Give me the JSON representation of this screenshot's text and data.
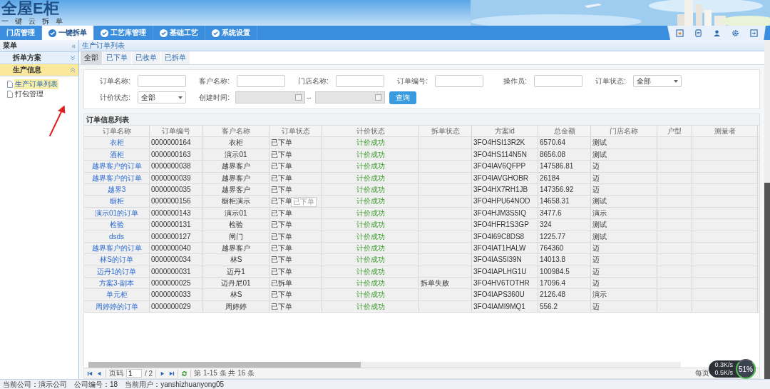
{
  "header": {
    "logo": "全屋E柜",
    "slogan": "一键云拆单"
  },
  "nav": [
    {
      "label": "门店管理",
      "kind": "plain",
      "selected": false
    },
    {
      "label": "一键拆单",
      "kind": "icon",
      "selected": true
    },
    {
      "label": "工艺库管理",
      "kind": "icon",
      "selected": false
    },
    {
      "label": "基础工艺",
      "kind": "icon",
      "selected": false
    },
    {
      "label": "系统设置",
      "kind": "icon",
      "selected": false
    }
  ],
  "sidebar": {
    "title": "菜单",
    "collapse_glyph": "«",
    "sections": [
      {
        "label": "拆单方案",
        "expanded": false
      },
      {
        "label": "生产信息",
        "expanded": true,
        "children": [
          {
            "label": "生产订单列表",
            "selected": true
          },
          {
            "label": "打包管理",
            "selected": false
          }
        ]
      }
    ]
  },
  "breadcrumb": "生产订单列表",
  "status_tabs": [
    {
      "label": "全部",
      "selected": true
    },
    {
      "label": "已下单",
      "selected": false
    },
    {
      "label": "已收单",
      "selected": false
    },
    {
      "label": "已拆单",
      "selected": false
    }
  ],
  "filters": [
    {
      "label": "订单名称:",
      "kind": "text"
    },
    {
      "label": "客户名称:",
      "kind": "text"
    },
    {
      "label": "门店名称:",
      "kind": "text"
    },
    {
      "label": "订单编号:",
      "kind": "text"
    },
    {
      "label": "操作员:",
      "kind": "text"
    },
    {
      "label": "订单状态:",
      "kind": "select",
      "value": "全部"
    }
  ],
  "filters_row2": [
    {
      "label": "计价状态:",
      "kind": "select",
      "value": "全部"
    },
    {
      "label": "创建时间:",
      "kind": "daterange",
      "separator": "--",
      "disabled": true
    }
  ],
  "search_button": "查询",
  "table": {
    "title": "订单信息列表",
    "columns": [
      "订单名称",
      "订单编号",
      "客户名称",
      "订单状态",
      "计价状态",
      "拆单状态",
      "方案id",
      "总金额",
      "门店名称",
      "户型",
      "测量者"
    ],
    "rows": [
      {
        "name": "衣柜",
        "number": "0000000164",
        "customer": "衣柜",
        "order_status": "已下单",
        "pricing_status": "计价成功",
        "scheme_id": "3FO4HSI13R2K",
        "amount": "6570.64",
        "store": "测试"
      },
      {
        "name": "酒柜",
        "number": "0000000163",
        "customer": "演示01",
        "order_status": "已下单",
        "pricing_status": "计价成功",
        "scheme_id": "3FO4HS114N5N",
        "amount": "8656.08",
        "store": "测试"
      },
      {
        "name": "越界客户的订单",
        "number": "0000000038",
        "customer": "越界客户",
        "order_status": "已下单",
        "pricing_status": "计价成功",
        "scheme_id": "3FO4IAV6QFPP",
        "amount": "147586.81",
        "store": "迈"
      },
      {
        "name": "越界客户的订单",
        "number": "0000000039",
        "customer": "越界客户",
        "order_status": "已下单",
        "pricing_status": "计价成功",
        "scheme_id": "3FO4IAVGHOBR",
        "amount": "26184",
        "store": "迈"
      },
      {
        "name": "越界3",
        "number": "0000000035",
        "customer": "越界客户",
        "order_status": "已下单",
        "pricing_status": "计价成功",
        "scheme_id": "3FO4HX7RH1JB",
        "amount": "147356.92",
        "store": "迈"
      },
      {
        "name": "橱柜",
        "number": "0000000156",
        "customer": "橱柜演示",
        "order_status": "已下单",
        "pricing_status": "计价成功",
        "scheme_id": "3FO4HPU64NOD",
        "amount": "14658.31",
        "store": "测试",
        "tooltip": "已下单"
      },
      {
        "name": "演示01的订单",
        "number": "0000000143",
        "customer": "演示01",
        "order_status": "已下单",
        "pricing_status": "计价成功",
        "scheme_id": "3FO4HJM3S5IQ",
        "amount": "3477.6",
        "store": "演示"
      },
      {
        "name": "检验",
        "number": "0000000131",
        "customer": "检验",
        "order_status": "已下单",
        "pricing_status": "计价成功",
        "scheme_id": "3FO4HFR1S3GP",
        "amount": "324",
        "store": "测试"
      },
      {
        "name": "dsds",
        "number": "0000000127",
        "customer": "闸门",
        "order_status": "已下单",
        "pricing_status": "计价成功",
        "scheme_id": "3FO4I69C8DS8",
        "amount": "1225.77",
        "store": "测试"
      },
      {
        "name": "越界客户的订单",
        "number": "0000000040",
        "customer": "越界客户",
        "order_status": "已下单",
        "pricing_status": "计价成功",
        "scheme_id": "3FO4IAT1HALW",
        "amount": "764360",
        "store": "迈"
      },
      {
        "name": "林S的订单",
        "number": "0000000034",
        "customer": "林S",
        "order_status": "已下单",
        "pricing_status": "计价成功",
        "scheme_id": "3FO4IAS5I39N",
        "amount": "14013.8",
        "store": "迈"
      },
      {
        "name": "迈丹1的订单",
        "number": "0000000031",
        "customer": "迈丹1",
        "order_status": "已下单",
        "pricing_status": "计价成功",
        "scheme_id": "3FO4IAPLHG1U",
        "amount": "100984.5",
        "store": "迈"
      },
      {
        "name": "方案3-副本",
        "number": "0000000025",
        "customer": "迈丹尼01",
        "order_status": "已拆单",
        "pricing_status": "计价成功",
        "split_status": "拆单失败",
        "scheme_id": "3FO4HV6TOTHR",
        "amount": "17096.4",
        "store": "迈"
      },
      {
        "name": "单元柜",
        "number": "0000000033",
        "customer": "林S",
        "order_status": "已下单",
        "pricing_status": "计价成功",
        "scheme_id": "3FO4IAPS360U",
        "amount": "2126.48",
        "store": "演示"
      },
      {
        "name": "周婷婷的订单",
        "number": "0000000029",
        "customer": "周婷婷",
        "order_status": "已下单",
        "pricing_status": "计价成功",
        "scheme_id": "3FO4IAMI9MQ1",
        "amount": "556.2",
        "store": "迈"
      }
    ]
  },
  "pagination": {
    "page_label": "页码",
    "page": "1",
    "total_pages": "/ 2",
    "summary": "第 1-15 条  共 16 条",
    "per_page": "每页"
  },
  "status_bar": [
    "当前公司：演示公司",
    "公司编号：18",
    "当前用户：yanshizhuanyong05"
  ],
  "net_widget": {
    "upload": "0.3K/s",
    "download": "0.5K/s",
    "usage": "51%"
  }
}
